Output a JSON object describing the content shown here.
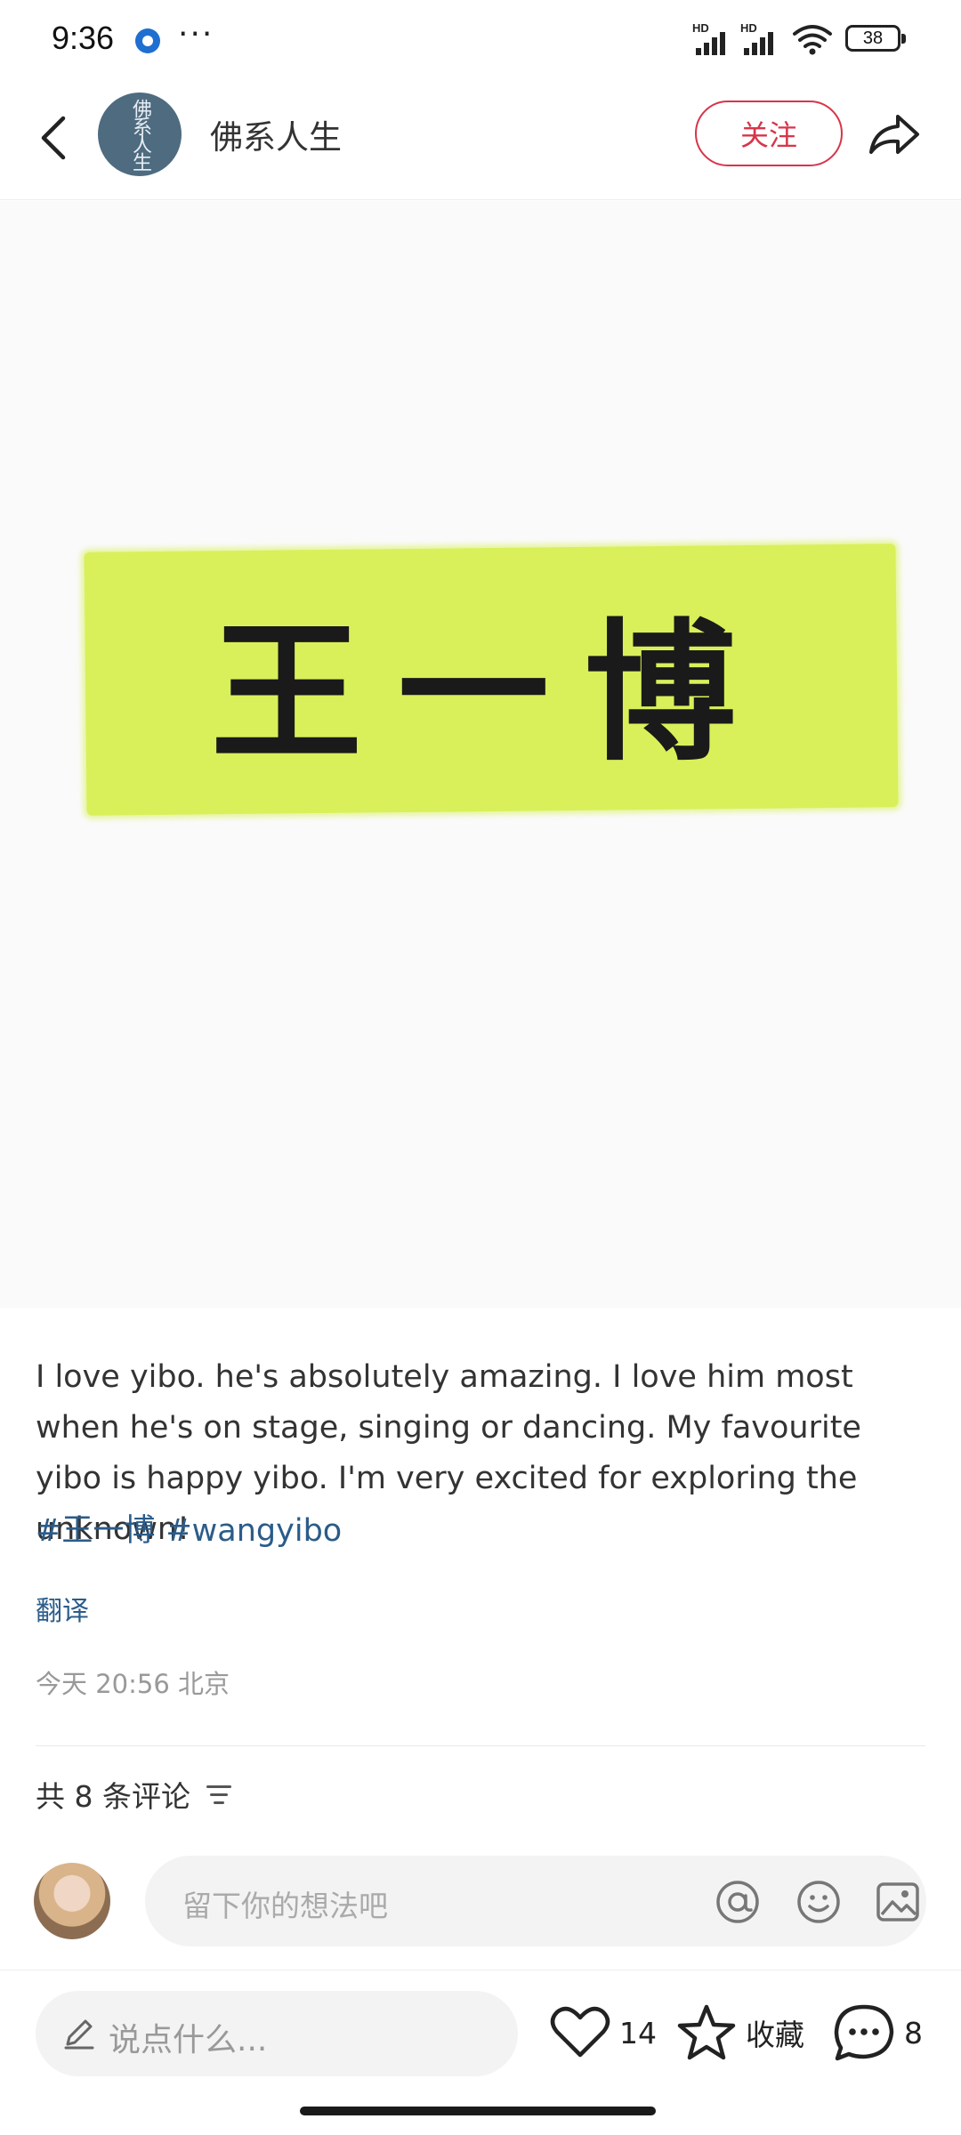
{
  "status_bar": {
    "time": "9:36",
    "dots": "···",
    "signal_label_1": "HD",
    "signal_label_2": "HD",
    "battery": "38"
  },
  "header": {
    "author_name": "佛系人生",
    "avatar_text": "佛系人生",
    "follow_label": "关注"
  },
  "post": {
    "image_text": "王一博",
    "highlight_color": "#d9f05a",
    "body": "I love yibo. he's absolutely amazing. I love him most when he's on stage, singing or dancing. My favourite yibo is happy yibo. I'm very excited for exploring the unknown!",
    "hashtags": [
      "#王一博",
      "#wangyibo"
    ],
    "translate_label": "翻译",
    "meta": "今天 20:56 北京"
  },
  "comments": {
    "count_label": "共 8 条评论",
    "input_placeholder": "留下你的想法吧"
  },
  "bottom_bar": {
    "say_placeholder": "说点什么...",
    "likes": "14",
    "favorite_label": "收藏",
    "comments": "8"
  },
  "colors": {
    "accent": "#d7354a",
    "link": "#2b5c8a"
  }
}
